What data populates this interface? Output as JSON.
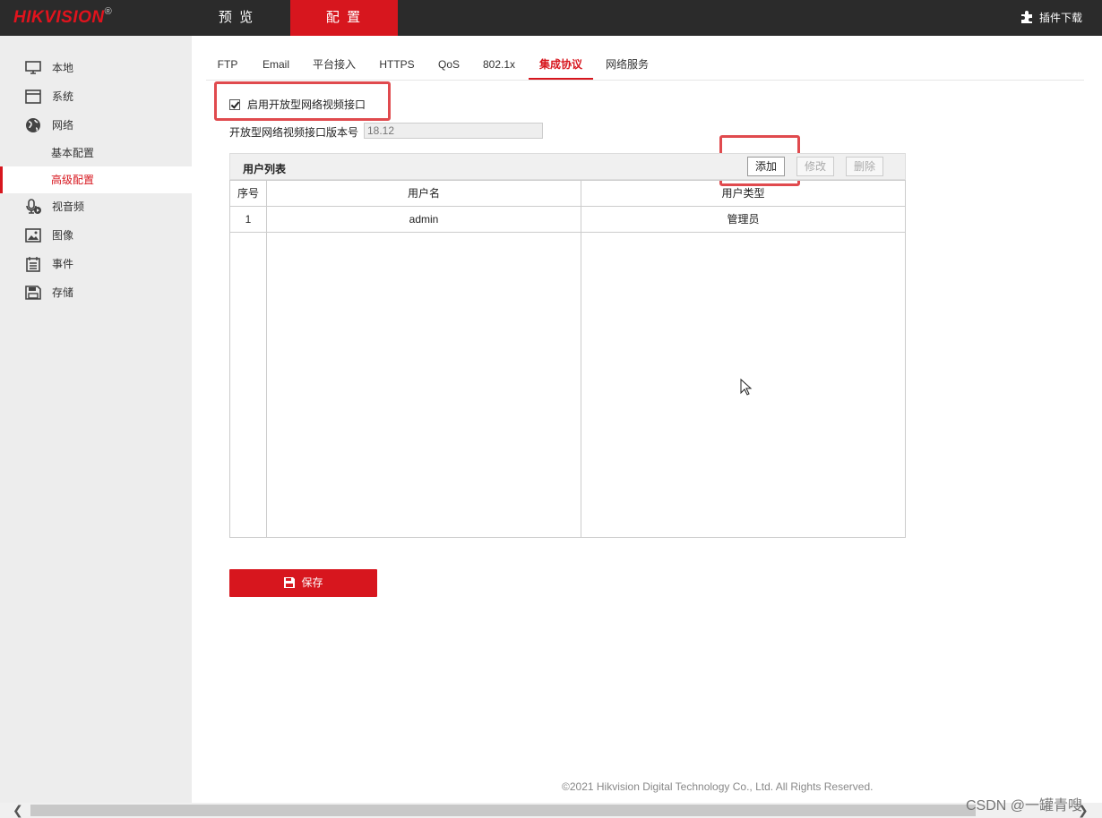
{
  "header": {
    "logo": "HIKVISION",
    "logo_mark": "®",
    "nav": [
      {
        "label": "预 览"
      },
      {
        "label": "配 置"
      }
    ],
    "plugin_label": "插件下载"
  },
  "sidebar": {
    "items": [
      {
        "label": "本地",
        "icon": "monitor-icon"
      },
      {
        "label": "系统",
        "icon": "window-icon"
      },
      {
        "label": "网络",
        "icon": "globe-icon"
      },
      {
        "label": "视音频",
        "icon": "microphone-icon"
      },
      {
        "label": "图像",
        "icon": "image-icon"
      },
      {
        "label": "事件",
        "icon": "calendar-icon"
      },
      {
        "label": "存储",
        "icon": "floppy-icon"
      }
    ],
    "network_sub": [
      {
        "label": "基本配置"
      },
      {
        "label": "高级配置"
      }
    ]
  },
  "tabs": [
    {
      "label": "FTP"
    },
    {
      "label": "Email"
    },
    {
      "label": "平台接入"
    },
    {
      "label": "HTTPS"
    },
    {
      "label": "QoS"
    },
    {
      "label": "802.1x"
    },
    {
      "label": "集成协议"
    },
    {
      "label": "网络服务"
    }
  ],
  "active_tab": "集成协议",
  "form": {
    "enable_label": "启用开放型网络视频接口",
    "enable_checked": true,
    "version_label": "开放型网络视频接口版本号",
    "version_value": "18.12"
  },
  "user_list": {
    "title": "用户列表",
    "add_label": "添加",
    "modify_label": "修改",
    "delete_label": "删除",
    "columns": [
      "序号",
      "用户名",
      "用户类型"
    ],
    "rows": [
      {
        "index": "1",
        "username": "admin",
        "type": "管理员"
      }
    ]
  },
  "save_label": "保存",
  "footer": "©2021 Hikvision Digital Technology Co., Ltd. All Rights Reserved.",
  "watermark": "CSDN @一罐青嗖",
  "colors": {
    "accent": "#d7161e",
    "topbar": "#2b2b2b",
    "sidebar": "#ededed",
    "highlight_box": "#e04a4e"
  }
}
